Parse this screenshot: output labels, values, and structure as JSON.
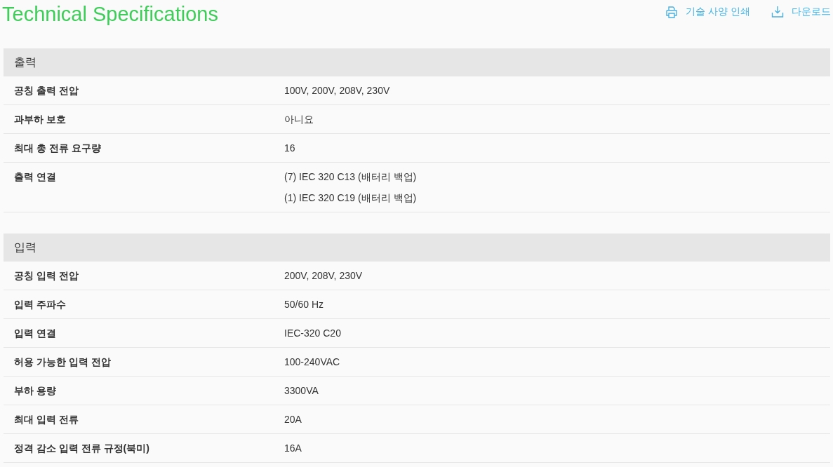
{
  "title": "Technical Specifications",
  "actions": [
    {
      "kind": "print",
      "label": "기술 사양 인쇄"
    },
    {
      "kind": "download",
      "label": "다운로드"
    }
  ],
  "sections": [
    {
      "heading": "출력",
      "rows": [
        {
          "label": "공칭 출력 전압",
          "values": [
            "100V, 200V, 208V, 230V"
          ]
        },
        {
          "label": "과부하 보호",
          "values": [
            "아니요"
          ]
        },
        {
          "label": "최대 총 전류 요구량",
          "values": [
            "16"
          ]
        },
        {
          "label": "출력 연결",
          "values": [
            "(7) IEC 320 C13 (배터리 백업)",
            "(1) IEC 320 C19 (배터리 백업)"
          ]
        }
      ]
    },
    {
      "heading": "입력",
      "rows": [
        {
          "label": "공칭 입력 전압",
          "values": [
            "200V, 208V, 230V"
          ]
        },
        {
          "label": "입력 주파수",
          "values": [
            "50/60 Hz"
          ]
        },
        {
          "label": "입력 연결",
          "values": [
            "IEC-320 C20"
          ]
        },
        {
          "label": "허용 가능한 입력 전압",
          "values": [
            "100-240VAC"
          ]
        },
        {
          "label": "부하 용량",
          "values": [
            "3300VA"
          ]
        },
        {
          "label": "최대 입력 전류",
          "values": [
            "20A"
          ]
        },
        {
          "label": "정격 감소 입력 전류 규정(북미)",
          "values": [
            "16A"
          ]
        }
      ]
    }
  ]
}
